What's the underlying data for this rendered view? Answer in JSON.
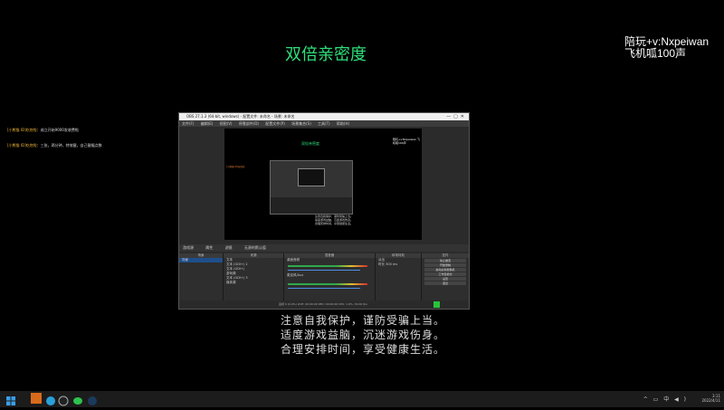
{
  "overlay": {
    "title": "双倍亲密度",
    "corner_line1": "陪玩+v:Nxpeiwan",
    "corner_line2": "飞机呱100声"
  },
  "chat": [
    {
      "user": "[小熊猫 ID]吃饱啦",
      "text": "：成立开始9000发收费啦"
    },
    {
      "user": "[小熊猫 ID]吃饱啦",
      "text": "：三张，两分钟，特效截，自己截幅点数"
    }
  ],
  "obs": {
    "window_title": "OBS 27.1.3 (64-bit, windows) - 配置文件: 未命名 - 场景: 未命名",
    "menu": [
      "文件(F)",
      "编辑(E)",
      "视图(V)",
      "停靠部件(D)",
      "配置文件(P)",
      "场景集合(S)",
      "工具(T)",
      "帮助(H)"
    ],
    "preview": {
      "title": "双倍亲密度",
      "corner": "陪玩+v:Nxpeiwan 飞机呱100声",
      "chat": "[小熊猫 ID]吃饱啦",
      "text_lines": [
        "注意自我保护，谨防受骗上当。",
        "适度游戏益脑，沉迷游戏伤身。",
        "合理安排时间，享受健康生活。"
      ]
    },
    "scene_toolbar": [
      "游戏源",
      "属性",
      "滤镜",
      "无源的默认值"
    ],
    "panels": {
      "scenes_header": "场景",
      "scenes": [
        "场景"
      ],
      "sources_header": "来源",
      "sources": [
        "文本",
        "文本 (GDI+) 2",
        "文本 (GDI+)",
        "游戏源",
        "文本 (GDI+) 3",
        "媒体源"
      ],
      "mixer_header": "混音器",
      "mixer": [
        "桌面音频",
        "麦克风/Aux"
      ],
      "transitions_header": "转场特效",
      "transition_value": "淡出",
      "duration_label": "时长",
      "duration_value": "300 ms",
      "controls_header": "控件",
      "controls": [
        "停止推流",
        "开始录制",
        "启动虚拟摄像机",
        "工作室模式",
        "设置",
        "退出"
      ]
    },
    "status": "丢帧 0 (0.0%)   LIVE: 00:00:00   REC: 00:00:00   CPU: 1.0%, 30.00 fps"
  },
  "notice": [
    "注意自我保护，谨防受骗上当。",
    "适度游戏益脑，沉迷游戏伤身。",
    "合理安排时间，享受健康生活。"
  ],
  "taskbar": {
    "tray": "^ ▭ 中 ◀ )",
    "time": "3:11",
    "date": "2022/4/11"
  },
  "colors": {
    "accent_green": "#2fe07a",
    "status_green": "#27c43a",
    "notice_gray": "#dddddd"
  }
}
